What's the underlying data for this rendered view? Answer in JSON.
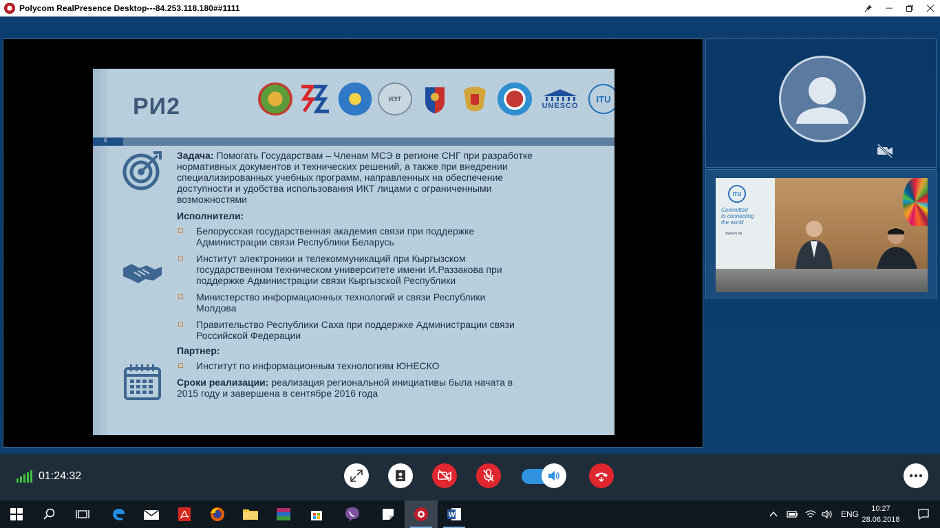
{
  "window": {
    "title": "Polycom RealPresence Desktop---84.253.118.180##1111",
    "controls": [
      "pin-icon",
      "minimize-icon",
      "maximize-icon",
      "close-icon"
    ]
  },
  "slide": {
    "title": "РИ2",
    "page_number": "6",
    "logos": [
      "belarus-emblem",
      "rcc-logo",
      "kyrgyzstan-emblem",
      "iet-logo",
      "moldova-emblem",
      "russia-emblem",
      "sakha-emblem",
      "unesco-logo",
      "itu-logo"
    ],
    "unesco_text": "UNESCO",
    "itu_text": "ITU",
    "task_label": "Задача:",
    "task_text_line1": " Помогать Государствам – Членам МСЭ в регионе СНГ при разработке",
    "task_text_lines": [
      "нормативных документов и технических решений, а также при внедрении",
      "специализированных учебных программ, направленных на обеспечение",
      "доступности и удобства использования ИКТ лицами с ограниченными",
      "возможностями"
    ],
    "executors_label": "Исполнители:",
    "executors": [
      [
        "Белорусская государственная академия связи при поддержке",
        "Администрации связи Республики Беларусь"
      ],
      [
        "Институт электроники и телекоммуникаций при Кыргызском",
        "государственном техническом университете имени И.Раззакова при",
        "поддержке Администрации связи Кыргызской Республики"
      ],
      [
        "Министерство информационных технологий и связи Республики",
        "Молдова"
      ],
      [
        "Правительство Республики Саха при поддержке Администрации связи",
        "Российской Федерации"
      ]
    ],
    "partner_label": "Партнер:",
    "partner": "Институт по информационным технологиям ЮНЕСКО",
    "terms_label": "Сроки реализации:",
    "terms_text_line1": " реализация региональной инициативы была начата в",
    "terms_text_line2": "2015 году и завершена в сентябре 2016 года"
  },
  "remote_video": {
    "itu_logo": "ITU",
    "tagline_lines": [
      "Committed",
      "to connecting",
      "the world"
    ],
    "url": "www.itu.int"
  },
  "controls": {
    "call_duration": "01:24:32",
    "buttons": [
      "fullscreen-icon",
      "content-share-icon",
      "camera-off-icon",
      "mic-off-icon",
      "speaker-toggle",
      "hangup-icon",
      "more-icon"
    ]
  },
  "taskbar": {
    "apps": [
      "start",
      "search",
      "task-view",
      "edge",
      "mail",
      "acrobat",
      "firefox",
      "file-explorer",
      "winrar",
      "store",
      "viber",
      "sticky-notes",
      "polycom",
      "word"
    ],
    "language": "ENG",
    "time": "10:27",
    "date": "28.06.2018"
  },
  "colors": {
    "hangup_red": "#e0262e",
    "toggle_blue": "#2f93e0",
    "signal_green": "#3fc23f",
    "stage_blue": "#0c3d6f"
  }
}
